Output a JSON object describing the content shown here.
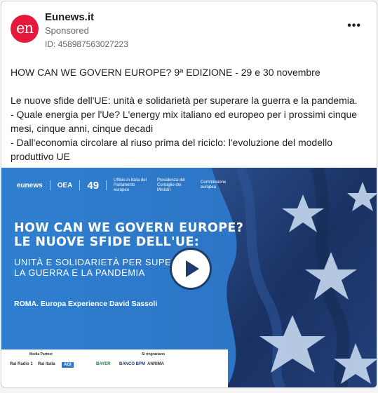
{
  "post": {
    "page_name": "Eunews.it",
    "avatar_text": "en",
    "sponsored_label": "Sponsored",
    "ad_id": "ID: 458987563027223",
    "more_icon": "more-options-icon"
  },
  "body": {
    "line1": "HOW CAN WE GOVERN EUROPE? 9ª EDIZIONE - 29 e 30 novembre",
    "line2": "Le nuove sfide dell'UE: unità e solidarietà per superare la guerra e la pandemia.",
    "line3": "- Quale energia per l'Ue? L'energy mix italiano ed europeo per i prossimi cinque mesi, cinque anni, cinque decadi",
    "line4": "- Dall'economia circolare al riuso prima del riciclo: l'evoluzione del modello produttivo UE"
  },
  "creative": {
    "logos": {
      "eunews": "eunews",
      "oea": "OEA",
      "anniversary": "49",
      "parliament": "Ufficio in Italia del Parlamento europeo",
      "ministry": "Presidenza del Consiglio dei Ministri",
      "commission": "Commissione europea"
    },
    "headline1": "HOW CAN WE GOVERN EUROPE?",
    "headline2": "LE NUOVE SFIDE DELL'UE:",
    "subline1": "UNITÀ E SOLIDARIETÀ PER SUPERARE",
    "subline2": "LA GUERRA E LA PANDEMIA",
    "location": "ROMA. Europa Experience David Sassoli",
    "media_partner_label": "Media Partner",
    "thanks_label": "Si ringraziano",
    "media_partners": [
      "Rai Radio 1",
      "Rai Italia",
      "AGI"
    ],
    "sponsors": [
      "BAYER",
      "BANCO BPM",
      "ANRIMA"
    ],
    "colors": {
      "sky": "#2c77c8",
      "flag": "#1e3a6e",
      "star": "#c6d8ef"
    }
  }
}
